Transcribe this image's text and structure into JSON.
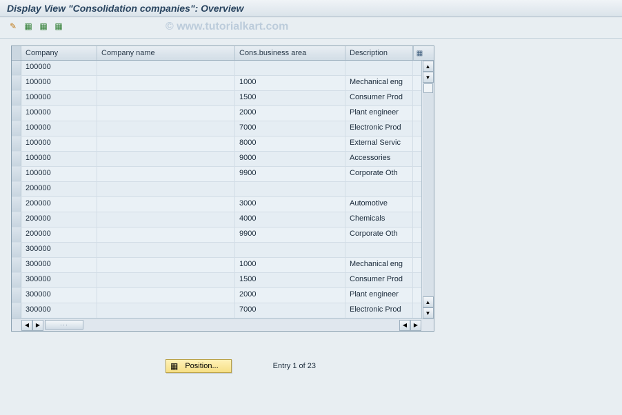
{
  "title": "Display View \"Consolidation companies\": Overview",
  "watermark": "© www.tutorialkart.com",
  "toolbar": {
    "btn1": "✎",
    "btn2": "▦",
    "btn3": "▦",
    "btn4": "▦"
  },
  "columns": {
    "company": "Company",
    "name": "Company name",
    "bus": "Cons.business area",
    "desc": "Description"
  },
  "rows": [
    {
      "company": "100000",
      "name": "",
      "bus": "",
      "desc": ""
    },
    {
      "company": "100000",
      "name": "",
      "bus": "1000",
      "desc": "Mechanical eng"
    },
    {
      "company": "100000",
      "name": "",
      "bus": "1500",
      "desc": "Consumer Prod"
    },
    {
      "company": "100000",
      "name": "",
      "bus": "2000",
      "desc": "Plant engineer"
    },
    {
      "company": "100000",
      "name": "",
      "bus": "7000",
      "desc": "Electronic Prod"
    },
    {
      "company": "100000",
      "name": "",
      "bus": "8000",
      "desc": "External Servic"
    },
    {
      "company": "100000",
      "name": "",
      "bus": "9000",
      "desc": "Accessories"
    },
    {
      "company": "100000",
      "name": "",
      "bus": "9900",
      "desc": "Corporate Oth"
    },
    {
      "company": "200000",
      "name": "",
      "bus": "",
      "desc": ""
    },
    {
      "company": "200000",
      "name": "",
      "bus": "3000",
      "desc": "Automotive"
    },
    {
      "company": "200000",
      "name": "",
      "bus": "4000",
      "desc": "Chemicals"
    },
    {
      "company": "200000",
      "name": "",
      "bus": "9900",
      "desc": "Corporate Oth"
    },
    {
      "company": "300000",
      "name": "",
      "bus": "",
      "desc": ""
    },
    {
      "company": "300000",
      "name": "",
      "bus": "1000",
      "desc": "Mechanical eng"
    },
    {
      "company": "300000",
      "name": "",
      "bus": "1500",
      "desc": "Consumer Prod"
    },
    {
      "company": "300000",
      "name": "",
      "bus": "2000",
      "desc": "Plant engineer"
    },
    {
      "company": "300000",
      "name": "",
      "bus": "7000",
      "desc": "Electronic Prod"
    }
  ],
  "position_button": "Position...",
  "entry_text": "Entry 1 of 23"
}
